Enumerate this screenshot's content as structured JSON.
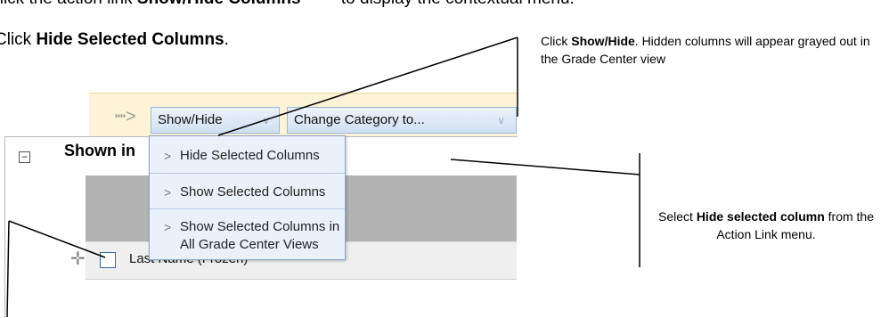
{
  "instructions": {
    "step1_prefix": "Click the action link ",
    "step1_bold": "Show/Hide Columns",
    "step1_suffix": " to display the contextual menu.",
    "step2_prefix": "Click ",
    "step2_bold": "Hide Selected Columns",
    "step2_suffix": "."
  },
  "callout_top": {
    "prefix": "Click ",
    "bold": "Show/Hide",
    "suffix": ". Hidden columns will appear grayed out in the Grade Center view"
  },
  "callout_right": {
    "prefix": "Select ",
    "bold": "Hide selected column",
    "suffix": " from the Action Link menu."
  },
  "action_bar": {
    "show_hide_label": "Show/Hide",
    "change_category_label": "Change Category to..."
  },
  "menu": {
    "items": [
      {
        "label_line1": "Hide Selected Columns",
        "label_line2": ""
      },
      {
        "label_line1": "Show Selected Columns",
        "label_line2": ""
      },
      {
        "label_line1": "Show Selected Columns in",
        "label_line2": "All Grade Center Views"
      }
    ]
  },
  "panel": {
    "title": "Shown in",
    "row_label": "Last Name (Frozen)"
  },
  "colors": {
    "action_bar_bg": "#fdf4d8",
    "menu_bg": "#eaf1fb",
    "menu_border": "#8aa8cc",
    "header_grey": "#b3b3b3"
  }
}
